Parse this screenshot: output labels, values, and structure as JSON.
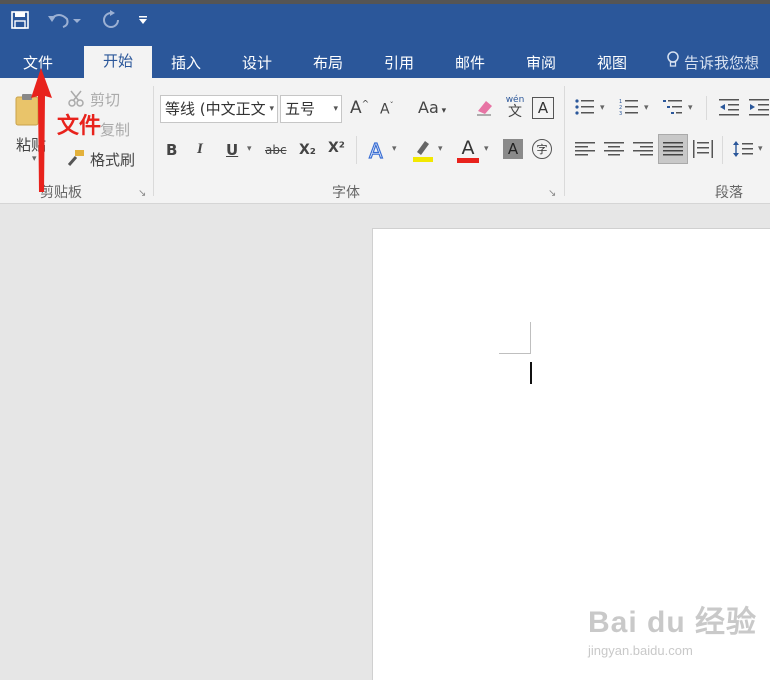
{
  "quick_access": {
    "save_icon": "save-icon",
    "undo_icon": "undo-icon",
    "redo_icon": "redo-icon",
    "customize_icon": "customize-qat-icon"
  },
  "tabs": [
    {
      "label": "文件",
      "active": false
    },
    {
      "label": "开始",
      "active": true
    },
    {
      "label": "插入",
      "active": false
    },
    {
      "label": "设计",
      "active": false
    },
    {
      "label": "布局",
      "active": false
    },
    {
      "label": "引用",
      "active": false
    },
    {
      "label": "邮件",
      "active": false
    },
    {
      "label": "审阅",
      "active": false
    },
    {
      "label": "视图",
      "active": false
    }
  ],
  "tell_me": "告诉我您想",
  "clipboard": {
    "paste_label": "粘贴",
    "cut_label": "剪切",
    "copy_label": "复制",
    "format_painter_label": "格式刷",
    "group_label": "剪贴板"
  },
  "font": {
    "font_name": "等线 (中文正文",
    "font_size": "五号",
    "case_label": "Aa",
    "bold": "B",
    "italic": "I",
    "underline": "U",
    "strikethrough": "abc",
    "subscript": "X₂",
    "superscript": "X²",
    "enclose_char": "字",
    "char_border": "A",
    "shading_letter": "A",
    "font_color_letter": "A",
    "phonetic_top": "wén",
    "phonetic_bottom": "文",
    "group_label": "字体",
    "font_color": "#e8221c",
    "highlight_color": "#f2e800"
  },
  "paragraph": {
    "group_label": "段落"
  },
  "annotation": {
    "text": "文件",
    "color": "#e8221c"
  },
  "watermark": {
    "main": "Bai du 经验",
    "sub": "jingyan.baidu.com"
  },
  "colors": {
    "title_bar": "#2b579a",
    "ribbon_bg": "#f3f3f3"
  }
}
